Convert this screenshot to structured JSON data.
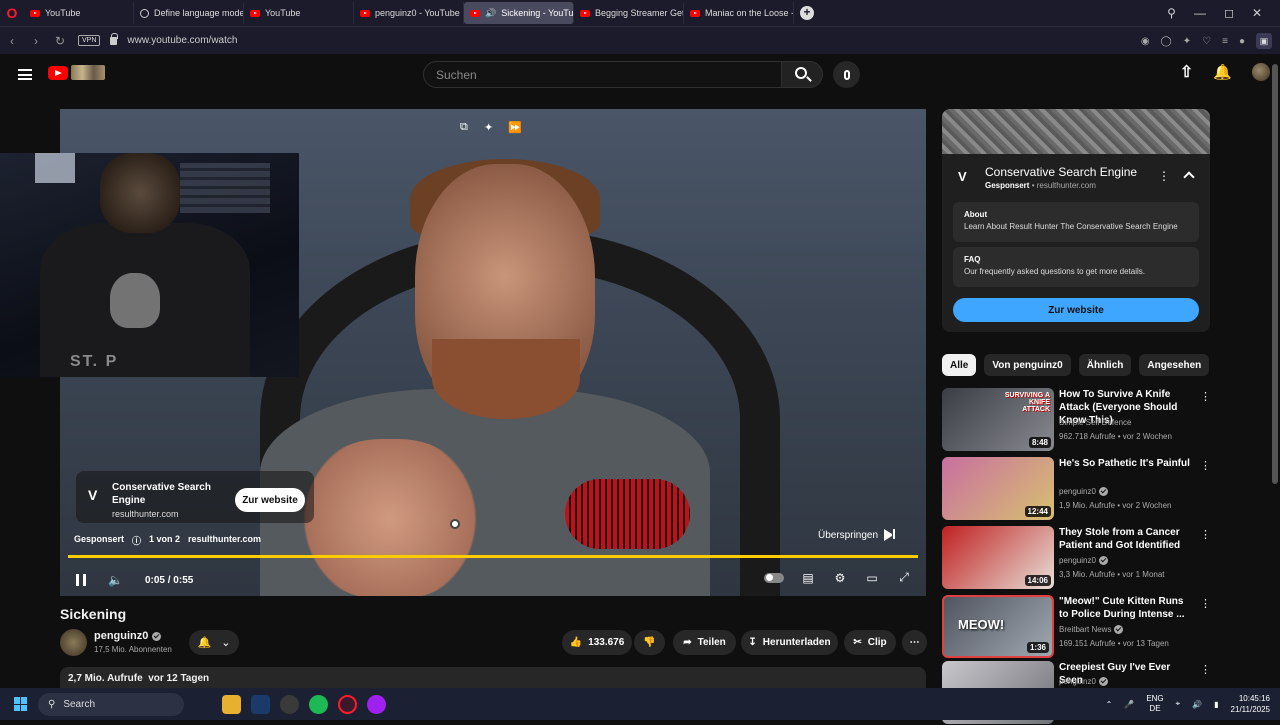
{
  "browser": {
    "tabs": [
      {
        "label": "YouTube",
        "icon": "youtube-icon"
      },
      {
        "label": "Define language model",
        "icon": "globe-icon"
      },
      {
        "label": "YouTube",
        "icon": "youtube-icon"
      },
      {
        "label": "penguinz0 - YouTube",
        "icon": "youtube-icon"
      },
      {
        "label": "Sickening - YouTube",
        "icon": "youtube-icon",
        "active": true
      },
      {
        "label": "Begging Streamer Gets Ca",
        "icon": "youtube-icon"
      },
      {
        "label": "Maniac on the Loose - Yo",
        "icon": "youtube-icon"
      }
    ],
    "vpn_label": "VPN",
    "url": "www.youtube.com/watch"
  },
  "yt": {
    "search_placeholder": "Suchen"
  },
  "video": {
    "ad": {
      "logo": "V",
      "title": "Conservative Search Engine",
      "domain": "resulthunter.com",
      "button": "Zur website",
      "sponsored": "Gesponsert",
      "count": "1 von 2",
      "meta_domain": "resulthunter.com",
      "skip": "Überspringen"
    },
    "progress": 0.0,
    "ad_progress": 1.0,
    "time": "0:05 / 0:55",
    "title": "Sickening"
  },
  "channel": {
    "name": "penguinz0",
    "subs": "17,5 Mio. Abonnenten"
  },
  "actions": {
    "likes": "133.676",
    "share": "Teilen",
    "download": "Herunterladen",
    "clip": "Clip"
  },
  "description": {
    "views": "2,7 Mio. Aufrufe",
    "age": "vor 12 Tagen"
  },
  "sidebar_ad": {
    "logo": "V",
    "title": "Conservative Search Engine",
    "sponsored": "Gesponsert",
    "domain": "resulthunter.com",
    "about_h": "About",
    "about_t": "Learn About Result Hunter The Conservative Search Engine",
    "faq_h": "FAQ",
    "faq_t": "Our frequently asked questions to get more details.",
    "button": "Zur website"
  },
  "chips": [
    "Alle",
    "Von penguinz0",
    "Ähnlich",
    "Angesehen"
  ],
  "related": [
    {
      "title": "How To Survive A Knife Attack (Everyone Should Know This)",
      "channel": "Simple Self Defence",
      "meta": "962.718 Aufrufe • vor 2 Wochen",
      "duration": "8:48",
      "verified": false,
      "thumb_colors": [
        "#3a3d44",
        "#888a90"
      ]
    },
    {
      "title": "He's So Pathetic It's Painful",
      "channel": "penguinz0",
      "meta": "1,9 Mio. Aufrufe • vor 2 Wochen",
      "duration": "12:44",
      "verified": true,
      "thumb_colors": [
        "#c86fa0",
        "#d8c070"
      ]
    },
    {
      "title": "They Stole from a Cancer Patient and Got Identified",
      "channel": "penguinz0",
      "meta": "3,3 Mio. Aufrufe • vor 1 Monat",
      "duration": "14:06",
      "verified": true,
      "thumb_colors": [
        "#c02020",
        "#e8e0d8"
      ]
    },
    {
      "title": "\"Meow!\" Cute Kitten Runs to Police During Intense ...",
      "channel": "Breitbart News",
      "meta": "169.151 Aufrufe • vor 13 Tagen",
      "duration": "1:36",
      "verified": true,
      "thumb_colors": [
        "#505560",
        "#a0a8b0"
      ]
    },
    {
      "title": "Creepiest Guy I've Ever Seen",
      "channel": "penguinz0",
      "meta": "",
      "duration": "",
      "verified": true,
      "thumb_colors": [
        "#c8c8cc",
        "#707078"
      ]
    }
  ],
  "thumb_captions": [
    "SURVIVING A KNIFE ATTACK",
    "MEOW!"
  ],
  "taskbar": {
    "search": "Search",
    "lang_top": "ENG",
    "lang_bottom": "DE",
    "time": "10:45:16",
    "date": "21/11/2025"
  }
}
